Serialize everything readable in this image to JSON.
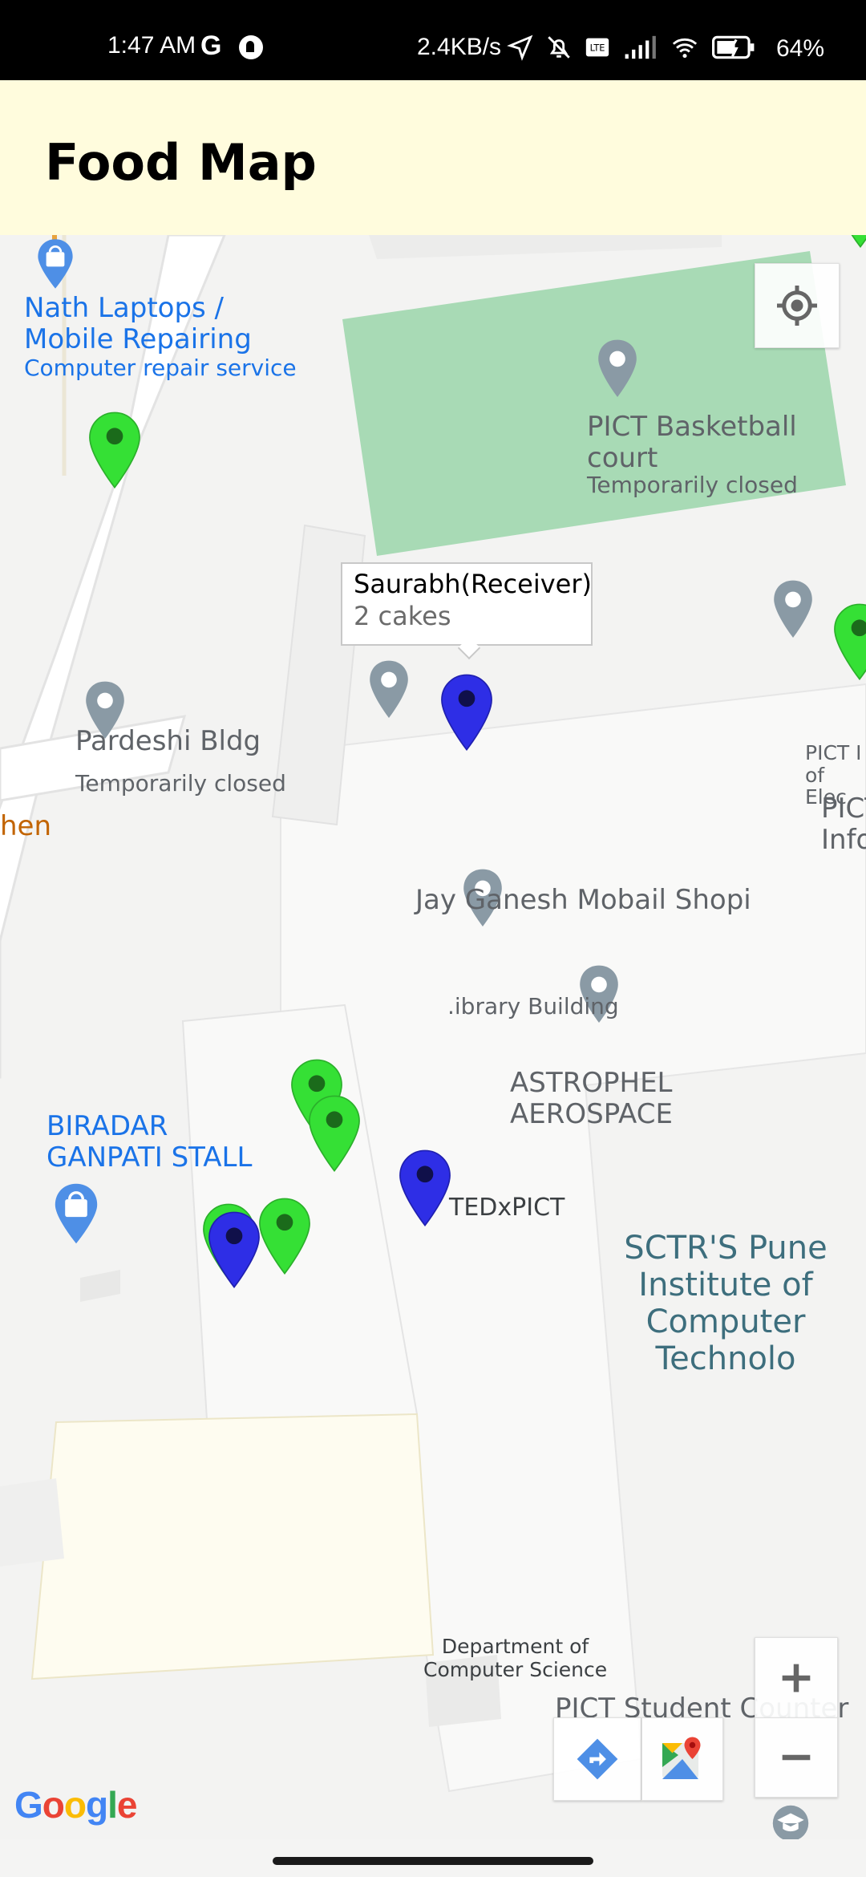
{
  "status_bar": {
    "time": "1:47 AM",
    "carrier_icon": "G",
    "speed": "2.4KB/s",
    "battery": "64%",
    "icons": [
      "location-arrow-icon",
      "mute-bell-icon",
      "volte-icon",
      "signal-icon",
      "wifi-icon",
      "battery-charging-icon"
    ]
  },
  "app_bar": {
    "title": "Food Map"
  },
  "map": {
    "poi_labels": {
      "nath_laptops_line1": "Nath Laptops /",
      "nath_laptops_line2": "Mobile Repairing",
      "nath_laptops_sub": "Computer repair service",
      "basketball_court": "PICT Basketball court",
      "basketball_status": "Temporarily closed",
      "pardeshi": "Pardeshi Bldg",
      "pardeshi_status": "Temporarily closed",
      "kitchen_partial": "hen",
      "pict_elec_line1": "PICT I",
      "pict_elec_line2": "of Elec",
      "pict_info_line1": "PICT",
      "pict_info_line2": "Info",
      "jay_ganesh": "Jay Ganesh Mobail Shopi",
      "library": ".ibrary Building",
      "astrophel_line1": "ASTROPHEL",
      "astrophel_line2": "AEROSPACE",
      "biradar_line1": "BIRADAR",
      "biradar_line2": "GANPATI STALL",
      "tedx": "TEDxPICT",
      "sctr_line1": "SCTR'S Pune",
      "sctr_line2": "Institute of",
      "sctr_line3": "Computer",
      "sctr_line4": "Technolo",
      "dept_line1": "Department of",
      "dept_line2": "Computer Science",
      "student_counter": "PICT Student Counter"
    },
    "info_window": {
      "title": "Saurabh(Receiver)",
      "snippet": "2 cakes"
    },
    "google_logo": "Google",
    "colors": {
      "donor_pin": "#35e035",
      "receiver_pin": "#2e2ee6",
      "poi_pin": "#8a9aa5",
      "park": "#a8dab5",
      "road": "#ffffff"
    }
  }
}
